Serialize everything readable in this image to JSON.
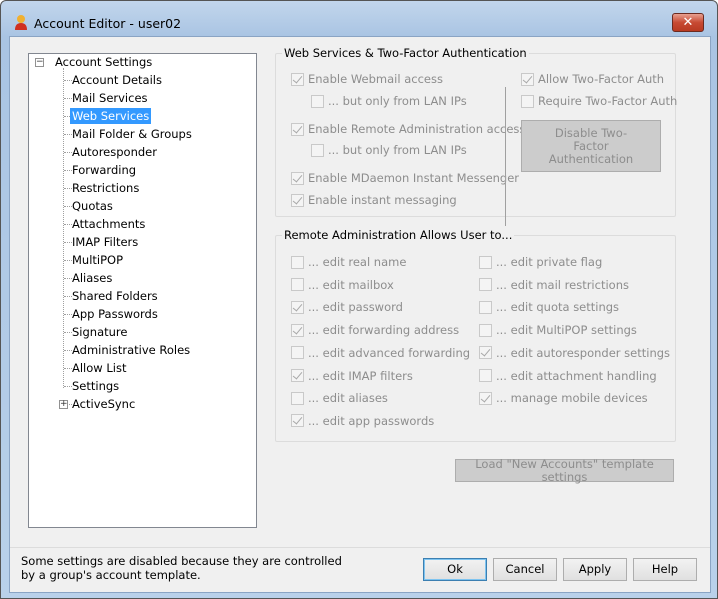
{
  "window": {
    "title": "Account Editor - user02",
    "close_label": "✕"
  },
  "tree": {
    "root": "Account Settings",
    "items": [
      "Account Details",
      "Mail Services",
      "Web Services",
      "Mail Folder & Groups",
      "Autoresponder",
      "Forwarding",
      "Restrictions",
      "Quotas",
      "Attachments",
      "IMAP Filters",
      "MultiPOP",
      "Aliases",
      "Shared Folders",
      "App Passwords",
      "Signature",
      "Administrative Roles",
      "Allow List",
      "Settings",
      "ActiveSync"
    ],
    "selected": "Web Services"
  },
  "web_services": {
    "title": "Web Services & Two-Factor Authentication",
    "left": [
      {
        "label": "Enable Webmail access",
        "checked": true,
        "indent": false
      },
      {
        "label": "... but only from LAN IPs",
        "checked": false,
        "indent": true
      },
      {
        "label": "Enable Remote Administration access",
        "checked": true,
        "indent": false
      },
      {
        "label": "... but only from LAN IPs",
        "checked": false,
        "indent": true
      },
      {
        "label": "Enable MDaemon Instant Messenger",
        "checked": true,
        "indent": false
      },
      {
        "label": "Enable instant messaging",
        "checked": true,
        "indent": false
      }
    ],
    "right": [
      {
        "label": "Allow Two-Factor Auth",
        "checked": true
      },
      {
        "label": "Require Two-Factor Auth",
        "checked": false
      }
    ],
    "disable_2fa_label": "Disable Two-Factor Authentication"
  },
  "remote_admin": {
    "title": "Remote Administration Allows User to...",
    "left": [
      {
        "label": "... edit real name",
        "checked": false
      },
      {
        "label": "... edit mailbox",
        "checked": false
      },
      {
        "label": "... edit password",
        "checked": true
      },
      {
        "label": "... edit forwarding address",
        "checked": true
      },
      {
        "label": "... edit advanced forwarding",
        "checked": false
      },
      {
        "label": "... edit IMAP filters",
        "checked": true
      },
      {
        "label": "... edit aliases",
        "checked": false
      },
      {
        "label": "... edit app passwords",
        "checked": true
      }
    ],
    "right": [
      {
        "label": "... edit private flag",
        "checked": false
      },
      {
        "label": "... edit mail restrictions",
        "checked": false
      },
      {
        "label": "... edit quota settings",
        "checked": false
      },
      {
        "label": "... edit MultiPOP settings",
        "checked": false
      },
      {
        "label": "... edit autoresponder settings",
        "checked": true
      },
      {
        "label": "... edit attachment handling",
        "checked": false
      },
      {
        "label": "... manage mobile devices",
        "checked": true
      }
    ]
  },
  "load_template_label": "Load \"New Accounts\" template settings",
  "footer": {
    "note_line1": "Some settings are disabled because they are controlled",
    "note_line2": "by a group's account template.",
    "ok": "Ok",
    "cancel": "Cancel",
    "apply": "Apply",
    "help": "Help"
  }
}
